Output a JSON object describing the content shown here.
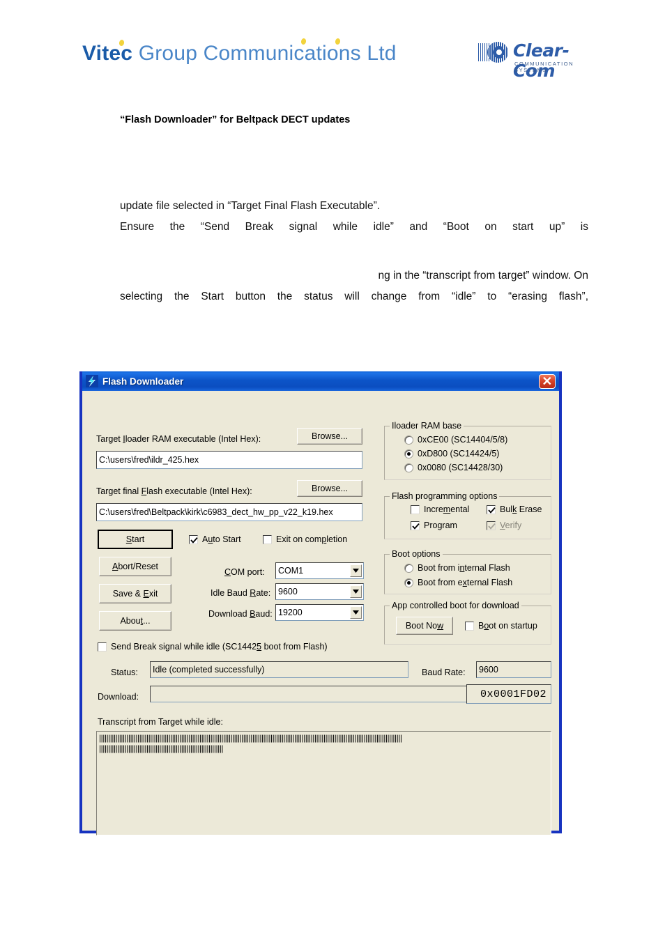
{
  "page": {
    "vitec_logo": {
      "bold_part": "Vitec",
      "rest": " Group Communications Ltd"
    },
    "clearcom_logo": {
      "wordmark": "Clear-Com",
      "tagline": "COMMUNICATION SYSTEMS"
    },
    "doc_title": "“Flash Downloader” for Beltpack DECT updates",
    "paragraph1_line1": "update file selected in “Target Final Flash Executable”.",
    "paragraph1_line2": "Ensure the “Send Break signal while idle” and “Boot on start up” is",
    "paragraph2_line1": "ng in the “transcript from target” window. On",
    "paragraph2_line2": "selecting the Start button the status will change from “idle” to “erasing flash”,"
  },
  "dialog": {
    "title": "Flash Downloader",
    "close_label": "close-icon",
    "iloader": {
      "label": "Target Iloader RAM executable (Intel Hex):",
      "label_pre": "Target ",
      "label_accel": "I",
      "label_post": "loader RAM executable (Intel Hex):",
      "browse_label": "Browse...",
      "path": "C:\\users\\fred\\ildr_425.hex"
    },
    "flash": {
      "label_pre": "Target final ",
      "label_accel": "F",
      "label_post": "lash executable (Intel Hex):",
      "browse_label": "Browse...",
      "path": "C:\\users\\fred\\Beltpack\\kirk\\c6983_dect_hw_pp_v22_k19.hex"
    },
    "buttons": {
      "start_pre": "",
      "start_accel": "S",
      "start_post": "tart",
      "abort_pre": "",
      "abort_accel": "A",
      "abort_post": "bort/Reset",
      "save_exit_pre": "Save & ",
      "save_exit_accel": "E",
      "save_exit_post": "xit",
      "about_pre": "Abou",
      "about_accel": "t",
      "about_post": "..."
    },
    "auto_start": {
      "pre": "A",
      "accel": "u",
      "post": "to Start",
      "checked": true
    },
    "exit_on_completion": {
      "pre": "Exit on com",
      "accel": "p",
      "post": "letion",
      "checked": false
    },
    "com_port": {
      "label_pre": "",
      "label_accel": "C",
      "label_post": "OM port:",
      "value": "COM1"
    },
    "idle_baud": {
      "label_pre": "Idle Baud ",
      "label_accel": "R",
      "label_post": "ate:",
      "value": "9600"
    },
    "download_baud": {
      "label_pre": "Download ",
      "label_accel": "B",
      "label_post": "aud:",
      "value": "19200"
    },
    "iloader_ram_base": {
      "title": "Iloader RAM base",
      "options": [
        {
          "label": "0xCE00 (SC14404/5/8)",
          "selected": false
        },
        {
          "label": "0xD800 (SC14424/5)",
          "selected": true
        },
        {
          "label": "0x0080 (SC14428/30)",
          "selected": false
        }
      ]
    },
    "flash_programming_options": {
      "title": "Flash programming options",
      "incremental": {
        "pre": "Incre",
        "accel": "m",
        "post": "ental",
        "checked": false,
        "disabled": false
      },
      "bulk_erase": {
        "pre": "Bul",
        "accel": "k",
        "post": " Erase",
        "checked": true,
        "disabled": false
      },
      "program": {
        "pre": "Program",
        "accel": "",
        "post": "",
        "checked": true,
        "disabled": false
      },
      "verify": {
        "pre": "",
        "accel": "V",
        "post": "erify",
        "checked": true,
        "disabled": true
      }
    },
    "boot_options": {
      "title": "Boot options",
      "options": [
        {
          "pre": "Boot from i",
          "accel": "n",
          "post": "ternal Flash",
          "selected": false
        },
        {
          "pre": "Boot from e",
          "accel": "x",
          "post": "ternal Flash",
          "selected": true
        }
      ]
    },
    "app_controlled_boot": {
      "title": "App controlled boot for download",
      "boot_now_pre": "Boot No",
      "boot_now_accel": "w",
      "boot_now_post": "",
      "boot_on_startup": {
        "pre": "B",
        "accel": "o",
        "post": "ot on startup",
        "checked": false
      }
    },
    "send_break": {
      "pre": "Send Break signal while idle (SC1442",
      "accel": "5",
      "post": " boot from Flash)",
      "checked": false
    },
    "status": {
      "label": "Status:",
      "value": "Idle (completed successfully)"
    },
    "baud_rate": {
      "label": "Baud Rate:",
      "value": "9600"
    },
    "download": {
      "label": "Download:",
      "value": "",
      "address": "0x0001FD02"
    },
    "transcript": {
      "label": "Transcript from Target while idle:",
      "line1": "||||||||||||||||||||||||||||||||||||||||||||||||||||||||||||||||||||||||||||||||||||||||||||||||||||||||||||||||||||||||||||||||||||||||||||||||||||||||||||||||||||||",
      "line2": "||||||||||||||||||||||||||||||||||||||||||||||||||||||||||||||||||||"
    }
  }
}
